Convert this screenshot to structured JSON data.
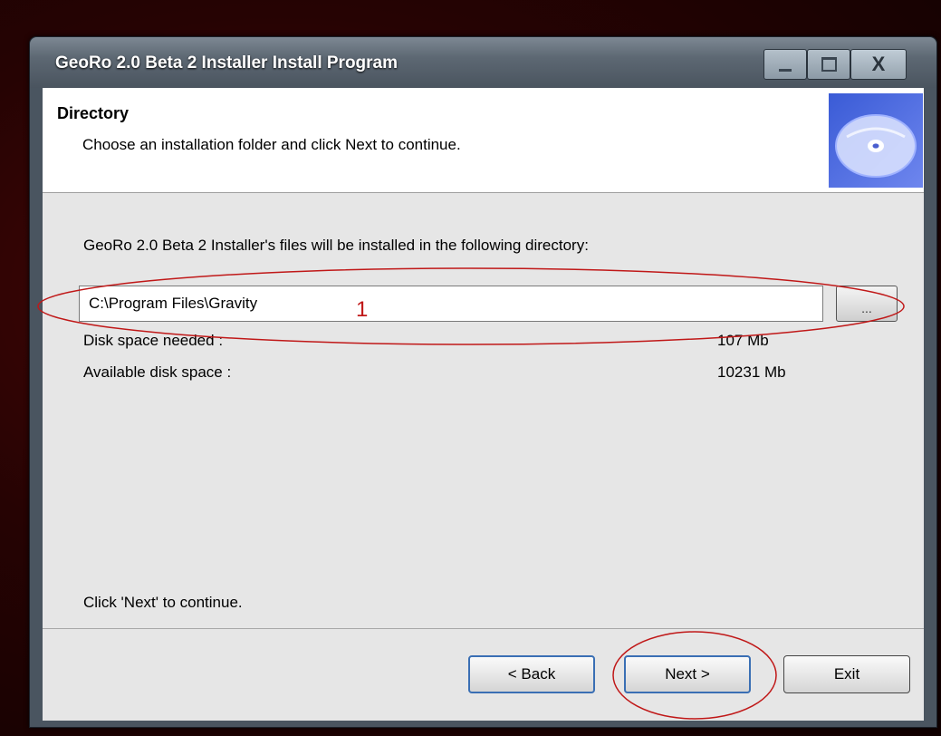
{
  "window": {
    "title": "GeoRo 2.0 Beta 2 Installer Install Program",
    "close_glyph": "X"
  },
  "header": {
    "title": "Directory",
    "subtitle": "Choose an installation folder and click Next to continue.",
    "image_icon": "cd-disc-icon"
  },
  "main": {
    "intro": "GeoRo 2.0 Beta 2 Installer's files will be installed in the following directory:",
    "path_value": "C:\\Program Files\\Gravity",
    "browse_label": "...",
    "disk_needed_label": "Disk space needed :",
    "disk_needed_value": "107 Mb",
    "disk_available_label": "Available disk space :",
    "disk_available_value": "10231 Mb",
    "footer_hint": "Click 'Next' to continue."
  },
  "buttons": {
    "back": "< Back",
    "next": "Next >",
    "exit": "Exit"
  },
  "annotation": {
    "marker_text": "1",
    "color": "#c01818"
  }
}
